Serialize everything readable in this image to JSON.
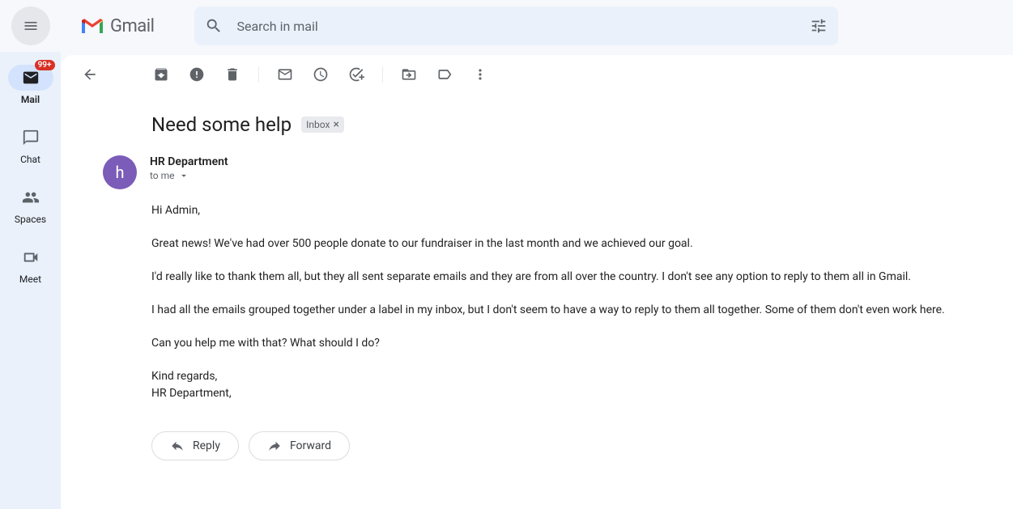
{
  "app": {
    "name": "Gmail"
  },
  "search": {
    "placeholder": "Search in mail"
  },
  "nav": {
    "mail": {
      "label": "Mail",
      "badge": "99+"
    },
    "chat": {
      "label": "Chat"
    },
    "spaces": {
      "label": "Spaces"
    },
    "meet": {
      "label": "Meet"
    }
  },
  "email": {
    "subject": "Need some help",
    "label": "Inbox",
    "sender": {
      "name": "HR Department",
      "initial": "h"
    },
    "recipient": "to me",
    "body": {
      "greeting": "Hi Admin,",
      "p1": "Great news! We've had over 500 people donate to our fundraiser in the last month and we achieved our goal.",
      "p2": "I'd really like to thank them all, but they all sent separate emails and they are from all over the country. I don't see any option to reply to them all in Gmail.",
      "p3": "I had all the emails grouped together under a label in my inbox, but I don't seem to have a way to reply to them all together. Some of them don't even work here.",
      "p4": "Can you help me with that? What should I do?",
      "signoff": "Kind regards,",
      "signature": "HR Department,"
    }
  },
  "actions": {
    "reply": "Reply",
    "forward": "Forward"
  }
}
